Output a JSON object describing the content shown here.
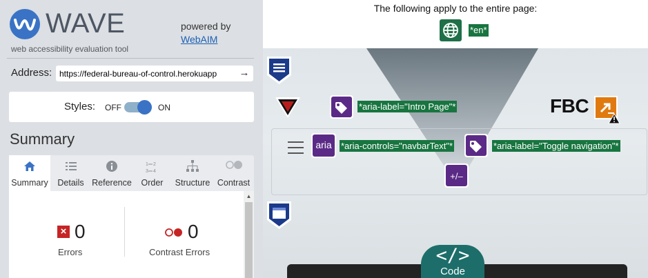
{
  "panel": {
    "app_name": "WAVE",
    "app_subtitle": "web accessibility evaluation tool",
    "powered_by": "powered by",
    "powered_link": "WebAIM",
    "address_label": "Address:",
    "address_value": "https://federal-bureau-of-control.herokuapp",
    "styles_label": "Styles:",
    "styles_off": "OFF",
    "styles_on": "ON",
    "styles_enabled": true,
    "summary_title": "Summary",
    "tabs": [
      {
        "label": "Summary",
        "icon": "home-icon",
        "active": true
      },
      {
        "label": "Details",
        "icon": "list-icon",
        "active": false
      },
      {
        "label": "Reference",
        "icon": "info-icon",
        "active": false
      },
      {
        "label": "Order",
        "icon": "order-icon",
        "active": false
      },
      {
        "label": "Structure",
        "icon": "structure-icon",
        "active": false
      },
      {
        "label": "Contrast",
        "icon": "contrast-icon",
        "active": false
      }
    ],
    "errors": {
      "count": "0",
      "label": "Errors"
    },
    "contrast_errors": {
      "count": "0",
      "label": "Contrast Errors"
    }
  },
  "viewer": {
    "page_notice": "The following apply to the entire page:",
    "lang_tag": "*en*",
    "site_logo_text": "FBC",
    "aria_tags": {
      "intro": "*aria-label=\"Intro Page\"*",
      "controls": "*aria-controls=\"navbarText\"*",
      "toggle": "*aria-label=\"Toggle navigation\"*"
    },
    "aria_badge_text": "aria",
    "expand_badge_text": "+/–",
    "code_button": {
      "symbol": "</>",
      "label": "Code"
    }
  },
  "colors": {
    "wave_blue": "#3a73c5",
    "aria_purple": "#5b2a86",
    "tag_green": "#187540",
    "code_teal": "#1d6e6a",
    "error_red": "#c62424"
  }
}
